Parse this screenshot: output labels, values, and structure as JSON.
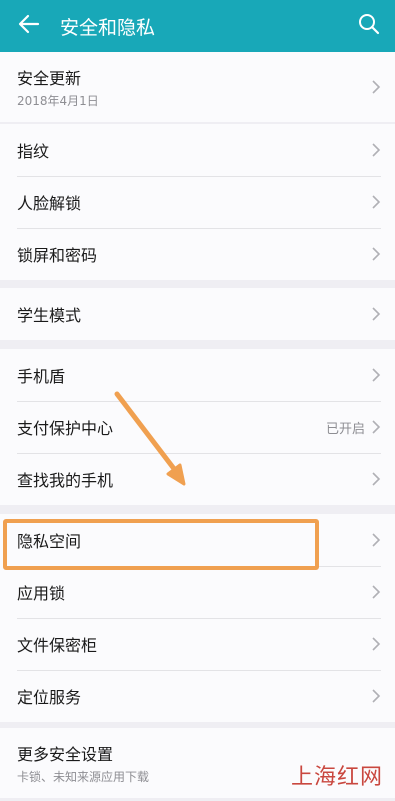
{
  "header": {
    "title": "安全和隐私",
    "back_icon": "back-arrow-icon",
    "search_icon": "search-icon",
    "color": "#18a8b8"
  },
  "groups": [
    {
      "items": [
        {
          "label": "安全更新",
          "sub": "2018年4月1日"
        }
      ]
    },
    {
      "items": [
        {
          "label": "指纹"
        },
        {
          "label": "人脸解锁"
        },
        {
          "label": "锁屏和密码"
        }
      ]
    },
    {
      "items": [
        {
          "label": "学生模式"
        }
      ]
    },
    {
      "items": [
        {
          "label": "手机盾"
        },
        {
          "label": "支付保护中心",
          "status": "已开启"
        },
        {
          "label": "查找我的手机"
        }
      ]
    },
    {
      "items": [
        {
          "label": "隐私空间"
        },
        {
          "label": "应用锁"
        },
        {
          "label": "文件保密柜"
        },
        {
          "label": "定位服务"
        }
      ]
    },
    {
      "items": [
        {
          "label": "更多安全设置",
          "sub": "卡锁、未知来源应用下载"
        }
      ]
    }
  ],
  "annotation": {
    "highlight_color": "#f0a050"
  },
  "watermark": "上海红网"
}
